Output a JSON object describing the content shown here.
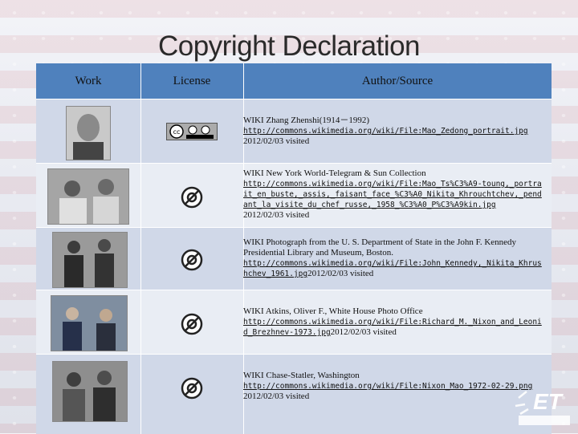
{
  "title": "Copyright Declaration",
  "columns": {
    "work": "Work",
    "license": "License",
    "source": "Author/Source"
  },
  "rows": [
    {
      "license": "cc-by-sa",
      "attribution": "WIKI  Zhang Zhenshi(1914－1992)",
      "url": "http://commons.wikimedia.org/wiki/File:Mao_Zedong_portrait.jpg",
      "after_url": "",
      "visited": "2012/02/03 visited"
    },
    {
      "license": "public-domain",
      "attribution": "WIKI New York World-Telegram & Sun Collection",
      "url": "http://commons.wikimedia.org/wiki/File:Mao_Ts%C3%A9-toung,_portrait_en_buste,_assis,_faisant_face_%C3%A0_Nikita_Khrouchtchev,_pendant_la_visite_du_chef_russe,_1958_%C3%A0_P%C3%A9kin.jpg",
      "after_url": "",
      "visited": "2012/02/03 visited"
    },
    {
      "license": "public-domain",
      "attribution": "WIKI Photograph from the U. S. Department of State in the John F. Kennedy Presidential Library and Museum, Boston.",
      "url": "http://commons.wikimedia.org/wiki/File:John_Kennedy,_Nikita_Khrushchev_1961.jpg",
      "after_url": "2012/02/03 visited",
      "visited": ""
    },
    {
      "license": "public-domain",
      "attribution": "WIKI Atkins, Oliver F., White House Photo Office",
      "url": "http://commons.wikimedia.org/wiki/File:Richard_M._Nixon_and_Leonid_Brezhnev-1973.jpg",
      "after_url": "2012/02/03 visited",
      "visited": ""
    },
    {
      "license": "public-domain",
      "attribution": "WIKI Chase-Statler, Washington",
      "url": "http://commons.wikimedia.org/wiki/File:Nixon_Mao_1972-02-29.png",
      "after_url": "",
      "visited": "2012/02/03 visited"
    }
  ],
  "icons": {
    "cc": "cc-by-sa-icon",
    "pd": "public-domain-icon"
  },
  "colors": {
    "header": "#4f81bd",
    "row_a": "#d0d8e8",
    "row_b": "#e9edf4"
  }
}
